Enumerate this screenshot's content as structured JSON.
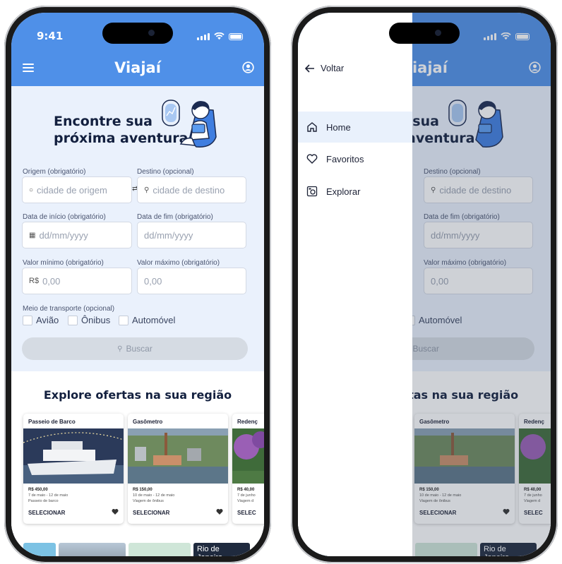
{
  "status": {
    "time": "9:41"
  },
  "app": {
    "brand": "Viajaí"
  },
  "hero": {
    "line1": "Encontre sua",
    "line2": "próxima aventura"
  },
  "form": {
    "origin_label": "Origem (obrigatório)",
    "origin_placeholder": "cidade de origem",
    "dest_label": "Destino (opcional)",
    "dest_placeholder": "cidade de destino",
    "start_label": "Data de início (obrigatório)",
    "start_placeholder": "dd/mm/yyyy",
    "end_label": "Data de fim (obrigatório)",
    "end_placeholder": "dd/mm/yyyy",
    "min_label": "Valor mínimo (obrigatório)",
    "min_prefix": "R$",
    "min_placeholder": "0,00",
    "max_label": "Valor máximo (obrigatório)",
    "max_placeholder": "0,00",
    "transport_label": "Meio de transporte (opcional)",
    "transport_options": [
      "Avião",
      "Ônibus",
      "Automóvel"
    ],
    "search_label": "Buscar"
  },
  "explore": {
    "title": "Explore ofertas na sua região",
    "cards": [
      {
        "title": "Passeio de Barco",
        "price": "R$ 450,00",
        "dates": "7 de maio - 12 de maio",
        "kind": "Passeio de barco",
        "select": "SELECIONAR"
      },
      {
        "title": "Gasômetro",
        "price": "R$ 150,00",
        "dates": "10 de maio - 12 de maio",
        "kind": "Viagem de ônibus",
        "select": "SELECIONAR"
      },
      {
        "title": "Redenç",
        "price": "R$ 40,00",
        "dates": "7 de junho",
        "kind": "Viagem d",
        "select": "SELEC"
      }
    ],
    "strip_city": "Rio de Janeiro"
  },
  "drawer": {
    "back_label": "Voltar",
    "items": [
      {
        "label": "Home",
        "icon": "home-icon",
        "active": true
      },
      {
        "label": "Favoritos",
        "icon": "heart-icon",
        "active": false
      },
      {
        "label": "Explorar",
        "icon": "explore-icon",
        "active": false
      }
    ]
  },
  "colors": {
    "primary": "#4f90e8",
    "background": "#eaf1fc",
    "navy": "#13203f"
  }
}
